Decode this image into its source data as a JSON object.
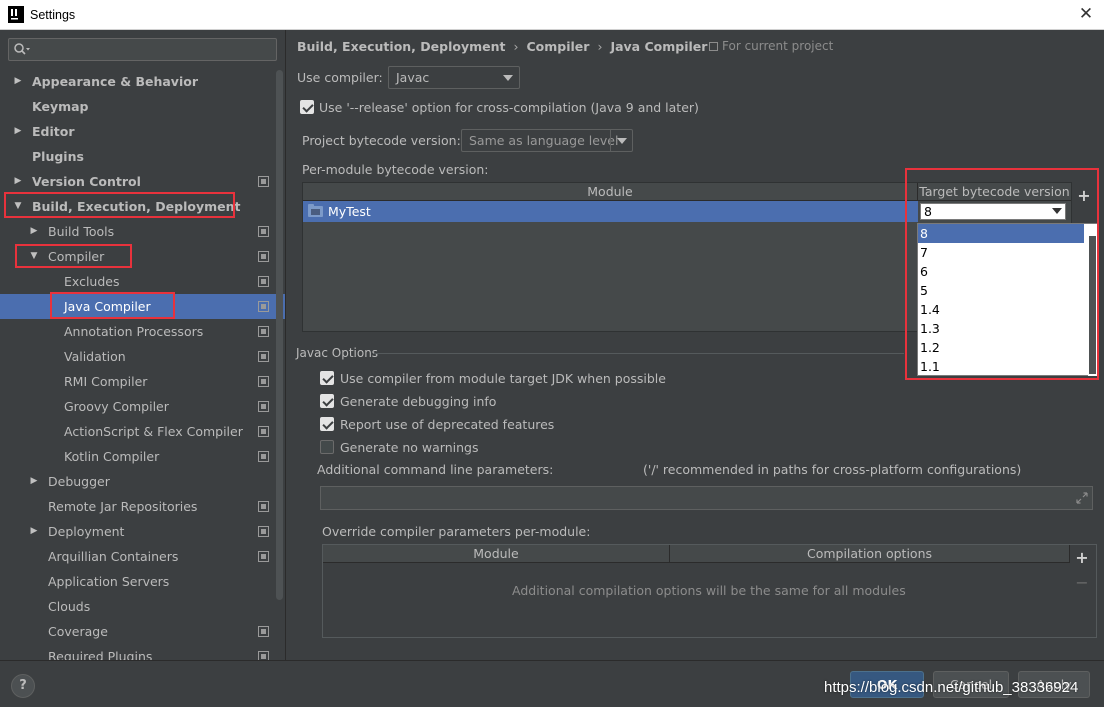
{
  "window": {
    "title": "Settings"
  },
  "sidebar": {
    "search_placeholder": "",
    "items": [
      {
        "label": "Appearance & Behavior",
        "level": 0,
        "arrow": "right",
        "bold": true,
        "project": false,
        "selected": false
      },
      {
        "label": "Keymap",
        "level": 0,
        "arrow": "",
        "bold": true,
        "project": false,
        "selected": false
      },
      {
        "label": "Editor",
        "level": 0,
        "arrow": "right",
        "bold": true,
        "project": false,
        "selected": false
      },
      {
        "label": "Plugins",
        "level": 0,
        "arrow": "",
        "bold": true,
        "project": false,
        "selected": false
      },
      {
        "label": "Version Control",
        "level": 0,
        "arrow": "right",
        "bold": true,
        "project": true,
        "selected": false
      },
      {
        "label": "Build, Execution, Deployment",
        "level": 0,
        "arrow": "down",
        "bold": true,
        "project": false,
        "selected": false
      },
      {
        "label": "Build Tools",
        "level": 1,
        "arrow": "right",
        "bold": false,
        "project": true,
        "selected": false
      },
      {
        "label": "Compiler",
        "level": 1,
        "arrow": "down",
        "bold": false,
        "project": true,
        "selected": false
      },
      {
        "label": "Excludes",
        "level": 2,
        "arrow": "",
        "bold": false,
        "project": true,
        "selected": false
      },
      {
        "label": "Java Compiler",
        "level": 2,
        "arrow": "",
        "bold": false,
        "project": true,
        "selected": true
      },
      {
        "label": "Annotation Processors",
        "level": 2,
        "arrow": "",
        "bold": false,
        "project": true,
        "selected": false
      },
      {
        "label": "Validation",
        "level": 2,
        "arrow": "",
        "bold": false,
        "project": true,
        "selected": false
      },
      {
        "label": "RMI Compiler",
        "level": 2,
        "arrow": "",
        "bold": false,
        "project": true,
        "selected": false
      },
      {
        "label": "Groovy Compiler",
        "level": 2,
        "arrow": "",
        "bold": false,
        "project": true,
        "selected": false
      },
      {
        "label": "ActionScript & Flex Compiler",
        "level": 2,
        "arrow": "",
        "bold": false,
        "project": true,
        "selected": false
      },
      {
        "label": "Kotlin Compiler",
        "level": 2,
        "arrow": "",
        "bold": false,
        "project": true,
        "selected": false
      },
      {
        "label": "Debugger",
        "level": 1,
        "arrow": "right",
        "bold": false,
        "project": false,
        "selected": false
      },
      {
        "label": "Remote Jar Repositories",
        "level": 1,
        "arrow": "",
        "bold": false,
        "project": true,
        "selected": false
      },
      {
        "label": "Deployment",
        "level": 1,
        "arrow": "right",
        "bold": false,
        "project": true,
        "selected": false
      },
      {
        "label": "Arquillian Containers",
        "level": 1,
        "arrow": "",
        "bold": false,
        "project": true,
        "selected": false
      },
      {
        "label": "Application Servers",
        "level": 1,
        "arrow": "",
        "bold": false,
        "project": false,
        "selected": false
      },
      {
        "label": "Clouds",
        "level": 1,
        "arrow": "",
        "bold": false,
        "project": false,
        "selected": false
      },
      {
        "label": "Coverage",
        "level": 1,
        "arrow": "",
        "bold": false,
        "project": true,
        "selected": false
      },
      {
        "label": "Required Plugins",
        "level": 1,
        "arrow": "",
        "bold": false,
        "project": true,
        "selected": false
      }
    ]
  },
  "breadcrumb": {
    "parts": [
      "Build, Execution, Deployment",
      "Compiler",
      "Java Compiler"
    ],
    "separator": "›",
    "scope_label": "For current project"
  },
  "compiler": {
    "use_compiler_label": "Use compiler:",
    "use_compiler_value": "Javac",
    "release_option_label": "Use '--release' option for cross-compilation (Java 9 and later)",
    "release_option_checked": true,
    "project_bytecode_label": "Project bytecode version:",
    "project_bytecode_value": "Same as language level",
    "per_module_label": "Per-module bytecode version:"
  },
  "module_table": {
    "headers": {
      "module": "Module",
      "target": "Target bytecode version"
    },
    "rows": [
      {
        "module": "MyTest",
        "target": "8"
      }
    ],
    "dropdown_options": [
      "8",
      "7",
      "6",
      "5",
      "1.4",
      "1.3",
      "1.2",
      "1.1"
    ],
    "dropdown_selected": "8",
    "add_symbol": "+"
  },
  "javac": {
    "section_title": "Javac Options",
    "options": [
      {
        "label": "Use compiler from module target JDK when possible",
        "checked": true
      },
      {
        "label": "Generate debugging info",
        "checked": true
      },
      {
        "label": "Report use of deprecated features",
        "checked": true
      },
      {
        "label": "Generate no warnings",
        "checked": false
      }
    ],
    "additional_params_label": "Additional command line parameters:",
    "additional_params_hint": "('/' recommended in paths for cross-platform configurations)",
    "additional_params_value": "",
    "override_label": "Override compiler parameters per-module:",
    "override_headers": {
      "module": "Module",
      "options": "Compilation options"
    },
    "override_empty_text": "Additional compilation options will be the same for all modules",
    "add_symbol": "+",
    "remove_symbol": "−"
  },
  "footer": {
    "help_label": "?",
    "ok_label": "OK",
    "cancel_label": "Cancel",
    "apply_label": "Apply",
    "watermark": "https://blog.csdn.net/github_38336924"
  },
  "colors": {
    "background": "#3c3f41",
    "selection": "#4b6eaf",
    "highlight_box": "#e8323c"
  }
}
